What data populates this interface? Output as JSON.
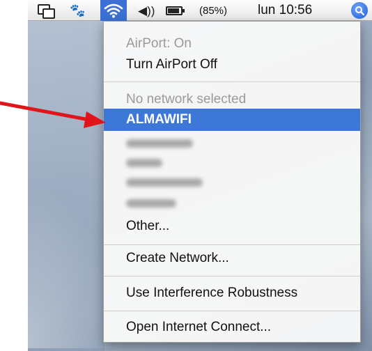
{
  "menubar": {
    "battery_text": "(85%)",
    "clock": "lun 10:56",
    "icons": [
      "screens-icon",
      "paw-icon",
      "wifi-icon",
      "volume-icon",
      "battery-icon",
      "spotlight-icon"
    ]
  },
  "airport_menu": {
    "status": "AirPort: On",
    "toggle": "Turn AirPort Off",
    "network_status": "No network selected",
    "selected_network": "ALMAWIFI",
    "other": "Other...",
    "create_network": "Create Network...",
    "interference": "Use Interference Robustness",
    "open_connect": "Open Internet Connect..."
  },
  "colors": {
    "highlight": "#3d78d8",
    "arrow": "#e0141a"
  }
}
